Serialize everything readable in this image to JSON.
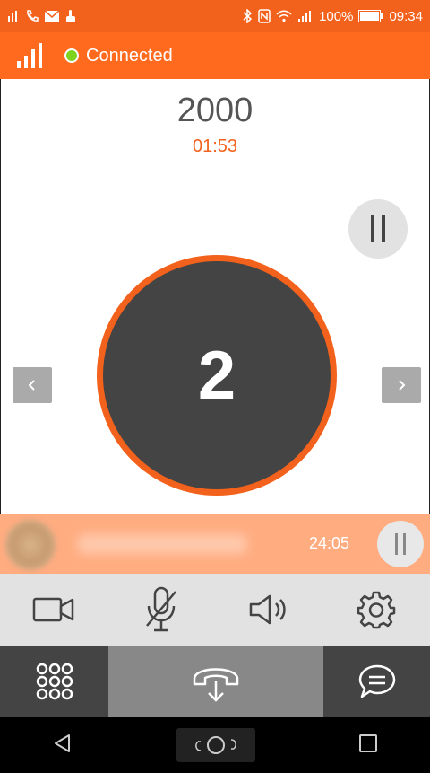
{
  "status_bar": {
    "battery": "100%",
    "time": "09:34"
  },
  "app_bar": {
    "status": "Connected"
  },
  "call": {
    "number": "2000",
    "timer": "01:53",
    "line": "2"
  },
  "held_call": {
    "duration": "24:05"
  },
  "colors": {
    "accent": "#ff6a1f",
    "connected": "#7ed321",
    "dark": "#444444"
  },
  "icons": {
    "video": "video-camera-icon",
    "mute": "mic-off-icon",
    "speaker": "speaker-icon",
    "settings": "gear-icon",
    "keypad": "keypad-icon",
    "transfer": "transfer-call-icon",
    "chat": "chat-icon"
  }
}
